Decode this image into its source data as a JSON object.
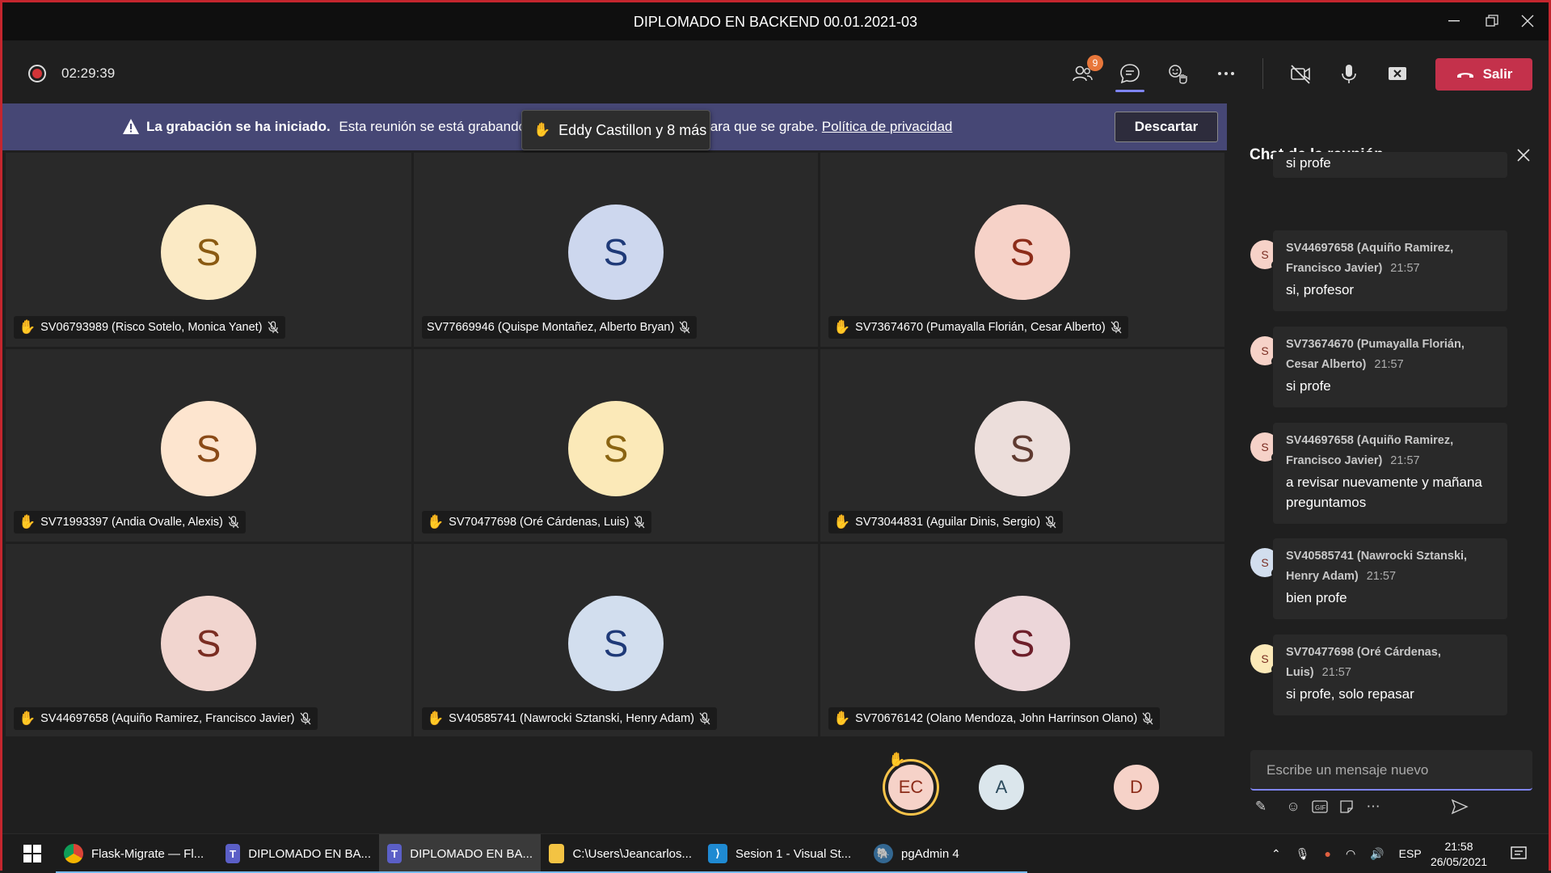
{
  "window": {
    "title": "DIPLOMADO EN BACKEND 00.01.2021-03",
    "controls": [
      "minimize",
      "restore",
      "close"
    ]
  },
  "toolbar": {
    "recording_time": "02:29:39",
    "participants_badge": "9",
    "leave_label": "Salir",
    "colors": {
      "leave": "#c4314b",
      "accent": "#7f85f5"
    }
  },
  "banner": {
    "title": "La grabación se ha iniciado.",
    "text_start": "Esta reunión se está grabando",
    "text_end": "nto para que se grabe.",
    "link": "Política de privacidad",
    "dismiss_label": "Descartar"
  },
  "hand_toast": {
    "text": "Eddy Castillon y 8 más"
  },
  "tiles": [
    {
      "initial": "S",
      "name": "SV06793989 (Risco Sotelo, Monica Yanet)",
      "hand": true,
      "bg": "#fbeac5",
      "fg": "#8a5a12"
    },
    {
      "initial": "S",
      "name": "SV77669946 (Quispe Montañez, Alberto Bryan)",
      "hand": false,
      "bg": "#cdd7ee",
      "fg": "#1f3a78"
    },
    {
      "initial": "S",
      "name": "SV73674670 (Pumayalla Florián, Cesar Alberto)",
      "hand": true,
      "bg": "#f6d2c8",
      "fg": "#8c2c19"
    },
    {
      "initial": "S",
      "name": "SV71993397 (Andia Ovalle, Alexis)",
      "hand": true,
      "bg": "#fde5cf",
      "fg": "#8a4a17"
    },
    {
      "initial": "S",
      "name": "SV70477698 (Oré Cárdenas, Luis)",
      "hand": true,
      "bg": "#fbe9b8",
      "fg": "#8a6412"
    },
    {
      "initial": "S",
      "name": "SV73044831 (Aguilar Dinis, Sergio)",
      "hand": true,
      "bg": "#ecdedb",
      "fg": "#5f3a30"
    },
    {
      "initial": "S",
      "name": "SV44697658 (Aquiño Ramirez, Francisco Javier)",
      "hand": true,
      "bg": "#f1d5cf",
      "fg": "#7a2d22"
    },
    {
      "initial": "S",
      "name": "SV40585741 (Nawrocki Sztanski, Henry Adam)",
      "hand": true,
      "bg": "#d2deee",
      "fg": "#1f3a78"
    },
    {
      "initial": "S",
      "name": "SV70676142 (Olano Mendoza, John Harrinson Olano)",
      "hand": true,
      "bg": "#ecd6d9",
      "fg": "#6e1f2a"
    }
  ],
  "strip": [
    {
      "initial": "EC",
      "bg": "#f6d2c8",
      "fg": "#8c2c19",
      "hand": true
    },
    {
      "initial": "A",
      "bg": "#dbe6ec",
      "fg": "#2b4a5c",
      "hand": false
    },
    {
      "initial": "D",
      "bg": "#f6d2c8",
      "fg": "#8c2c19",
      "hand": false
    }
  ],
  "chat": {
    "header": "Chat de la reunión",
    "partial_body": "si profe",
    "messages": [
      {
        "avatar": "S",
        "avatar_bg": "#f6d2c8",
        "status": "#6bb700",
        "sender": "SV44697658 (Aquiño Ramirez, Francisco Javier)",
        "time": "21:57",
        "body": "si, profesor"
      },
      {
        "avatar": "S",
        "avatar_bg": "#f6d2c8",
        "status": "#c4314b",
        "sender": "SV73674670 (Pumayalla Florián, Cesar Alberto)",
        "time": "21:57",
        "body": "si profe"
      },
      {
        "avatar": "S",
        "avatar_bg": "#f6d2c8",
        "status": "#6bb700",
        "sender": "SV44697658 (Aquiño Ramirez, Francisco Javier)",
        "time": "21:57",
        "body": "a revisar nuevamente y mañana preguntamos"
      },
      {
        "avatar": "S",
        "avatar_bg": "#d2deee",
        "status": "#c4314b",
        "sender": "SV40585741 (Nawrocki Sztanski, Henry Adam)",
        "time": "21:57",
        "body": "bien profe"
      },
      {
        "avatar": "S",
        "avatar_bg": "#fbe9b8",
        "status": "#c4314b",
        "sender": "SV70477698 (Oré Cárdenas, Luis)",
        "time": "21:57",
        "body": "si profe, solo repasar"
      }
    ],
    "compose_placeholder": "Escribe un mensaje nuevo"
  },
  "taskbar": {
    "items": [
      {
        "label": "Flask-Migrate — Fl...",
        "icon": "chrome-icon",
        "active": false
      },
      {
        "label": "DIPLOMADO EN BA...",
        "icon": "teams-icon",
        "active": false
      },
      {
        "label": "DIPLOMADO EN BA...",
        "icon": "teams-icon",
        "active": true
      },
      {
        "label": "C:\\Users\\Jeancarlos...",
        "icon": "folder-icon",
        "active": false
      },
      {
        "label": "Sesion 1 - Visual St...",
        "icon": "vscode-icon",
        "active": false
      },
      {
        "label": "pgAdmin 4",
        "icon": "pgadmin-icon",
        "active": false
      }
    ],
    "language": "ESP",
    "time": "21:58",
    "date": "26/05/2021"
  }
}
